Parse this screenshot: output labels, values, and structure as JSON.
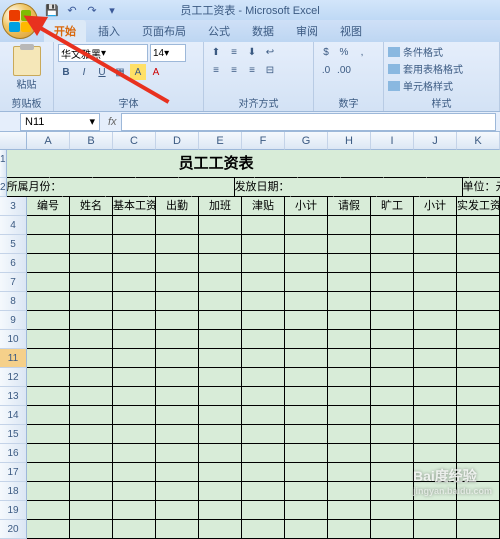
{
  "window": {
    "title": "员工工资表 - Microsoft Excel"
  },
  "tabs": {
    "home": "开始",
    "insert": "插入",
    "layout": "页面布局",
    "formula": "公式",
    "data": "数据",
    "review": "审阅",
    "view": "视图"
  },
  "ribbon": {
    "paste": "粘贴",
    "clipboard": "剪贴板",
    "font_name": "华文雅黑",
    "font_size": "14",
    "font_group": "字体",
    "align_group": "对齐方式",
    "num_group": "数字",
    "cond_fmt": "条件格式",
    "table_fmt": "套用表格格式",
    "cell_style": "单元格样式",
    "style_group": "样式"
  },
  "namebox": "N11",
  "columns": [
    "A",
    "B",
    "C",
    "D",
    "E",
    "F",
    "G",
    "H",
    "I",
    "J",
    "K"
  ],
  "rows": [
    "1",
    "2",
    "3",
    "4",
    "5",
    "6",
    "7",
    "8",
    "9",
    "10",
    "11",
    "12",
    "13",
    "14",
    "15",
    "16",
    "17",
    "18",
    "19",
    "20"
  ],
  "sheet": {
    "title": "员工工资表",
    "r2": {
      "month": "所属月份：",
      "paydate": "发放日期：",
      "unit": "单位：元"
    },
    "headers": [
      "编号",
      "姓名",
      "基本工资",
      "出勤",
      "加班",
      "津贴",
      "小计",
      "请假",
      "旷工",
      "小计",
      "实发工资"
    ]
  },
  "watermark": {
    "brand": "Bai度经验",
    "url": "jingyan.baidu.com"
  }
}
